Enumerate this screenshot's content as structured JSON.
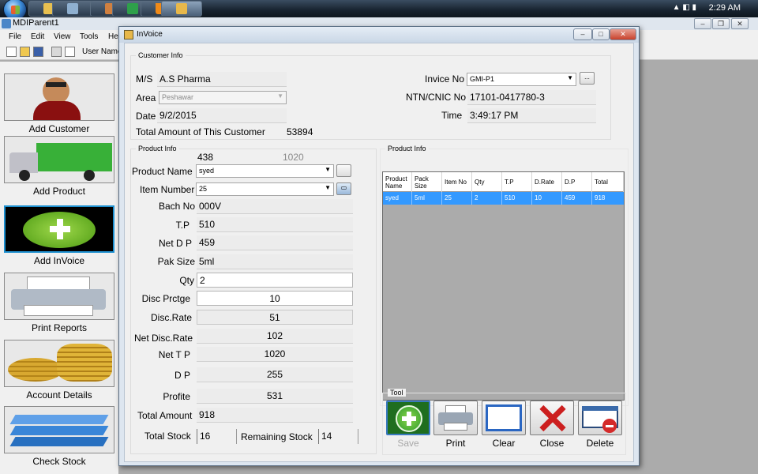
{
  "taskbar": {
    "clock": "2:29 AM"
  },
  "mdi": {
    "title": "MDIParent1",
    "menu": [
      "File",
      "Edit",
      "View",
      "Tools",
      "He"
    ],
    "toolbar_user_label": "User Name"
  },
  "sidebar": {
    "items": [
      {
        "label": "Add Customer",
        "icon": "customer-person-icon"
      },
      {
        "label": "Add Product",
        "icon": "truck-icon"
      },
      {
        "label": "Add InVoice",
        "icon": "plus-icon"
      },
      {
        "label": "Print Reports",
        "icon": "printer-icon"
      },
      {
        "label": "Account Details",
        "icon": "coins-icon"
      },
      {
        "label": "Check Stock",
        "icon": "stack-icon"
      }
    ]
  },
  "invoice": {
    "title": "InVoice",
    "customer_info": {
      "group_title": "Customer Info",
      "ms_label": "M/S",
      "ms_value": "A.S Pharma",
      "area_label": "Area",
      "area_value": "Peshawar",
      "date_label": "Date",
      "date_value": "9/2/2015",
      "total_label": "Total Amount of This Customer",
      "total_value": "53894",
      "invoice_no_label": "Invice No",
      "invoice_no_value": "GMI-P1",
      "ntn_label": "NTN/CNIC No",
      "ntn_value": "17101-0417780-3",
      "time_label": "Time",
      "time_value": "3:49:17 PM",
      "browse_button": "..."
    },
    "product_info": {
      "group_title": "Product Info",
      "top_left_value": "438",
      "top_right_value": "1020",
      "product_name_label": "Product Name",
      "product_name_value": "syed",
      "item_number_label": "Item Number",
      "item_number_value": "25",
      "bach_no_label": "Bach No",
      "bach_no_value": "000V",
      "tp_label": "T.P",
      "tp_value": "510",
      "net_dp_label": "Net D P",
      "net_dp_value": "459",
      "pak_size_label": "Pak Size",
      "pak_size_value": "5ml",
      "qty_label": "Qty",
      "qty_value": "2",
      "disc_prctge_label": "Disc Prctge",
      "disc_prctge_value": "10",
      "disc_rate_label": "Disc.Rate",
      "disc_rate_value": "51",
      "net_disc_rate_label": "Net Disc.Rate",
      "net_disc_rate_value": "102",
      "net_tp_label": "Net T P",
      "net_tp_value": "1020",
      "dp_label": "D P",
      "dp_value": "255",
      "profite_label": "Profite",
      "profite_value": "531",
      "total_amount_label": "Total Amount",
      "total_amount_value": "918",
      "total_stock_label": "Total Stock",
      "total_stock_value": "16",
      "remaining_stock_label": "Remaining Stock",
      "remaining_stock_value": "14"
    },
    "grid": {
      "group_title": "Product Info",
      "columns": [
        "Product Name",
        "Pack Size",
        "Item No",
        "Qty",
        "T.P",
        "D.Rate",
        "D.P",
        "Total"
      ],
      "rows": [
        [
          "syed",
          "5ml",
          "25",
          "2",
          "510",
          "10",
          "459",
          "918"
        ]
      ]
    },
    "tool": {
      "group_title": "Tool",
      "buttons": [
        {
          "label": "Save",
          "icon": "plus-icon",
          "enabled": false
        },
        {
          "label": "Print",
          "icon": "printer-icon",
          "enabled": true
        },
        {
          "label": "Clear",
          "icon": "blank-window-icon",
          "enabled": true
        },
        {
          "label": "Close",
          "icon": "red-x-icon",
          "enabled": true
        },
        {
          "label": "Delete",
          "icon": "delete-card-icon",
          "enabled": true
        }
      ]
    }
  },
  "colors": {
    "selection": "#3399ff",
    "save_green": "#2e9a2e",
    "close_red": "#cc1f1f"
  }
}
